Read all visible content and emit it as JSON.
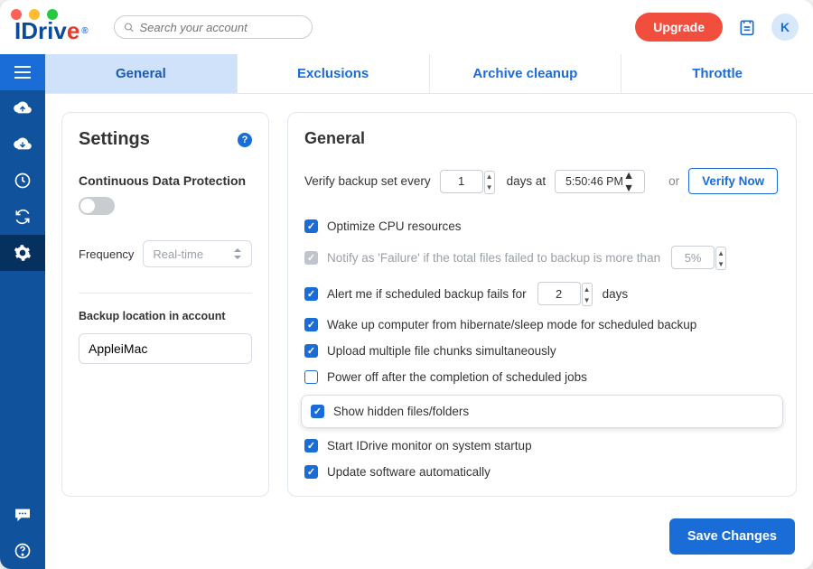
{
  "brand": {
    "name": "IDriv",
    "accent_char": "e",
    "reg": "®"
  },
  "search": {
    "placeholder": "Search your account"
  },
  "header": {
    "upgrade": "Upgrade",
    "avatar_initial": "K"
  },
  "sidebar_icons": [
    "menu",
    "cloud-up",
    "cloud-down",
    "clock",
    "sync",
    "gear",
    "chat",
    "help"
  ],
  "tabs": [
    {
      "label": "General",
      "active": true
    },
    {
      "label": "Exclusions",
      "active": false
    },
    {
      "label": "Archive cleanup",
      "active": false
    },
    {
      "label": "Throttle",
      "active": false
    }
  ],
  "left": {
    "title": "Settings",
    "cdp_label": "Continuous Data Protection",
    "cdp_on": false,
    "frequency_label": "Frequency",
    "frequency_value": "Real-time",
    "location_label": "Backup location in account",
    "location_value": "AppleiMac"
  },
  "right": {
    "title": "General",
    "verify": {
      "prefix": "Verify backup set every",
      "days_value": "1",
      "mid": "days at",
      "time_value": "5:50:46 PM",
      "or": "or",
      "button": "Verify Now"
    },
    "options": [
      {
        "key": "optimize",
        "checked": true,
        "muted": false,
        "label": "Optimize CPU resources"
      },
      {
        "key": "notify_fail",
        "checked": true,
        "muted": true,
        "label_pre": "Notify as 'Failure' if the total files failed to backup is more than",
        "value": "5%"
      },
      {
        "key": "alert_days",
        "checked": true,
        "muted": false,
        "label_pre": "Alert me if scheduled backup fails for",
        "value": "2",
        "label_post": "days"
      },
      {
        "key": "wake",
        "checked": true,
        "muted": false,
        "label": "Wake up computer from hibernate/sleep mode for scheduled backup"
      },
      {
        "key": "chunks",
        "checked": true,
        "muted": false,
        "label": "Upload multiple file chunks simultaneously"
      },
      {
        "key": "poweroff",
        "checked": false,
        "muted": false,
        "label": "Power off after the completion of scheduled jobs"
      },
      {
        "key": "hidden",
        "checked": true,
        "muted": false,
        "label": "Show hidden files/folders",
        "highlight": true
      },
      {
        "key": "monitor",
        "checked": true,
        "muted": false,
        "label": "Start IDrive monitor on system startup"
      },
      {
        "key": "autoupdate",
        "checked": true,
        "muted": false,
        "label": "Update software automatically"
      }
    ]
  },
  "footer": {
    "save": "Save Changes"
  },
  "colors": {
    "brand_blue": "#1a6dd6",
    "sidebar": "#10529c",
    "upgrade": "#f24e3e"
  }
}
